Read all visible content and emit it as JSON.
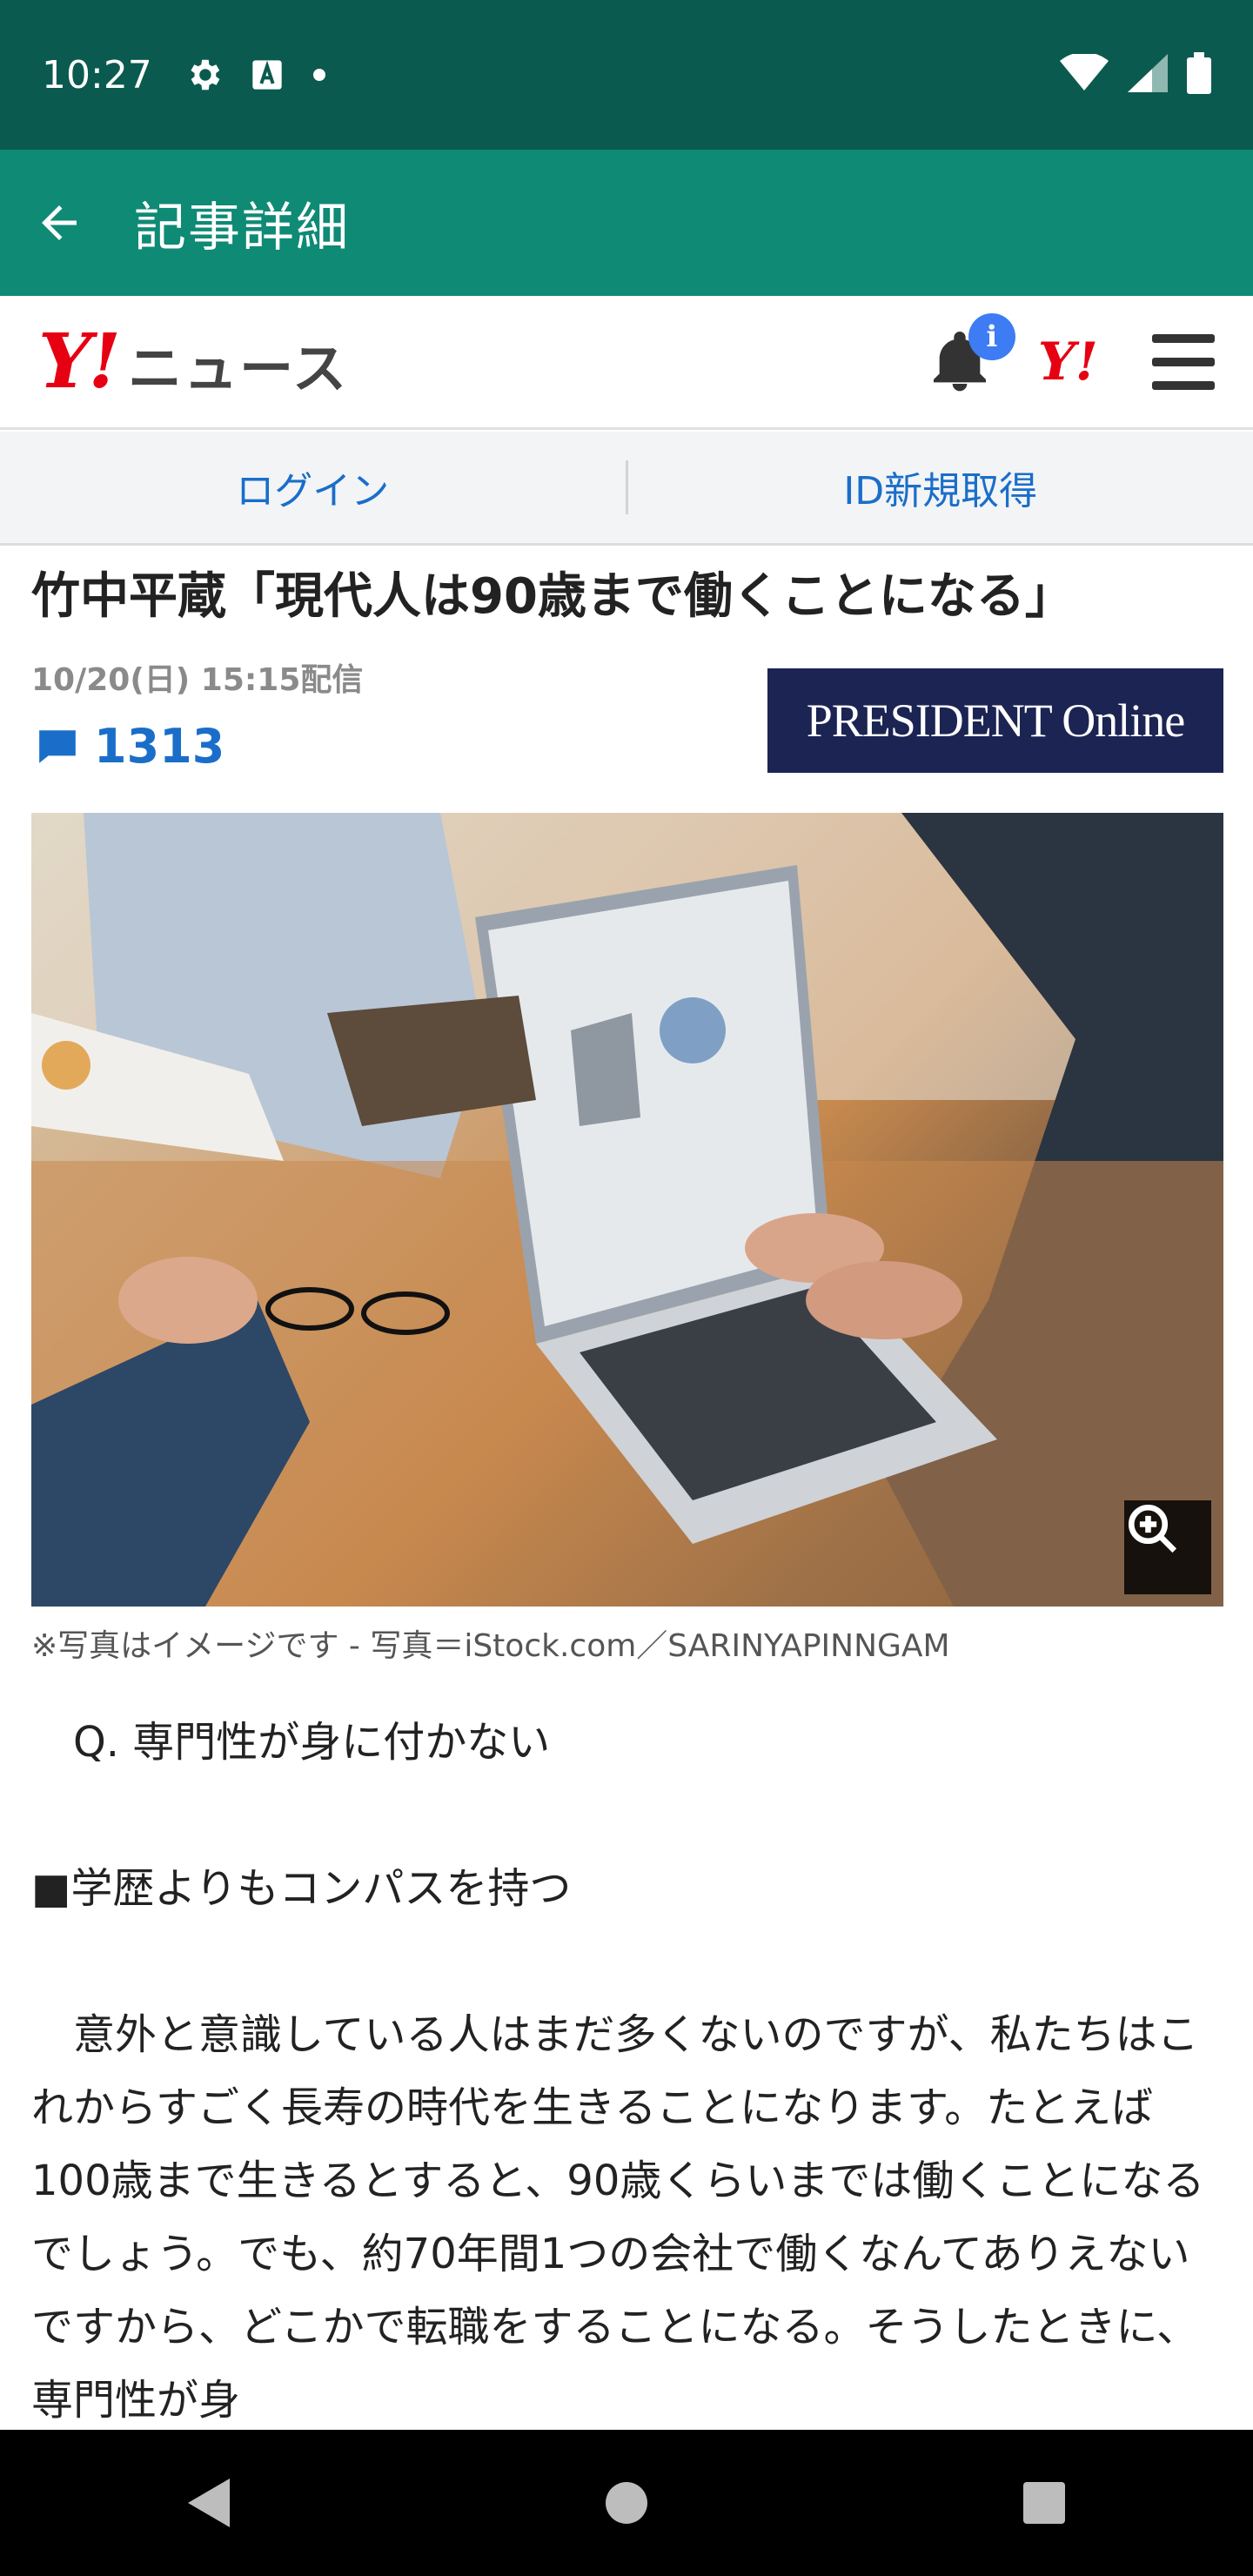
{
  "status_bar": {
    "time": "10:27",
    "icons": [
      "gear-icon",
      "text-a-icon",
      "dot-icon",
      "wifi-icon",
      "signal-icon",
      "battery-icon"
    ]
  },
  "app_bar": {
    "title": "記事詳細",
    "back_icon": "arrow-left-icon"
  },
  "site_header": {
    "logo_y": "Y!",
    "logo_news": "ニュース",
    "notification_badge": "i",
    "mini_logo": "Y!",
    "menu_icon": "hamburger-icon"
  },
  "login_bar": {
    "login": "ログイン",
    "register": "ID新規取得"
  },
  "article": {
    "title": "竹中平蔵「現代人は90歳まで働くことになる」",
    "date": "10/20(日) 15:15配信",
    "comment_count": "1313",
    "source": "PRESIDENT Online",
    "photo_caption": "※写真はイメージです - 写真＝iStock.com／SARINYAPINNGAM",
    "body": [
      "　Q. 専門性が身に付かない",
      "■学歴よりもコンパスを持つ",
      "　意外と意識している人はまだ多くないのですが、私たちはこれからすごく長寿の時代を生きることになります。たとえば100歳まで生きるとすると、90歳くらいまでは働くことになるでしょう。でも、約70年間1つの会社で働くなんてありえないですから、どこかで転職をすることになる。そうしたときに、専門性が身"
    ]
  },
  "colors": {
    "status_bar": "#0b5a4f",
    "app_bar": "#0e8a75",
    "yahoo_red": "#e60012",
    "link_blue": "#1a6ec9",
    "source_bg": "#1b2453"
  },
  "nav_bar": {
    "icons": [
      "back-triangle-icon",
      "home-circle-icon",
      "recents-square-icon"
    ]
  }
}
